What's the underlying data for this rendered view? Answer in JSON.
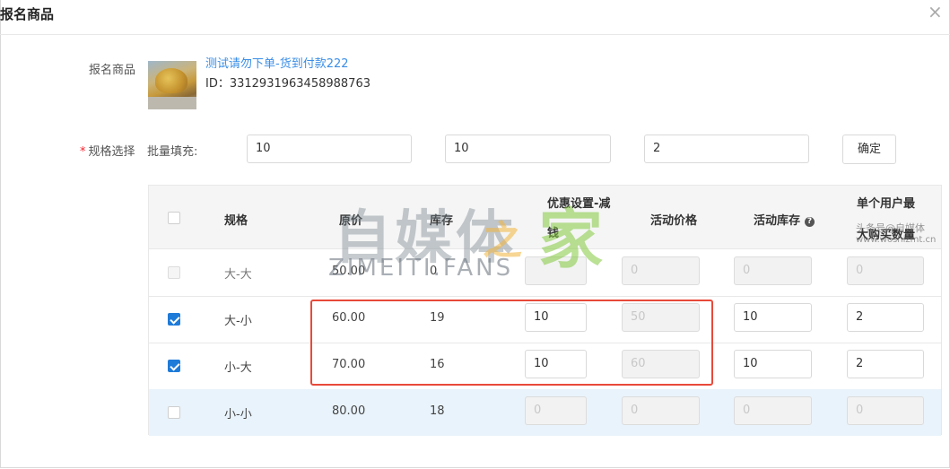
{
  "dialog": {
    "title": "报名商品",
    "close_icon": "×"
  },
  "product": {
    "label": "报名商品",
    "name": "测试请勿下单-货到付款222",
    "id_text": "ID：3312931963458988763",
    "thumbnail_icon": "tree-photo"
  },
  "spec": {
    "required_mark": "*",
    "label": "规格选择",
    "batch_label": "批量填充:",
    "batch_values": [
      "10",
      "10",
      "2"
    ],
    "confirm_label": "确定"
  },
  "table": {
    "headers": {
      "spec": "规格",
      "original_price": "原价",
      "stock": "库存",
      "discount_line1": "优惠设置-减",
      "discount_line2": "钱",
      "activity_price": "活动价格",
      "activity_stock": "活动库存",
      "limit_line1": "单个用户最",
      "limit_line2": "大购买数量"
    },
    "help_icon": "?",
    "rows": [
      {
        "checked": false,
        "spec": "大-大",
        "price": "50.00",
        "stock": "0",
        "discount": "",
        "activity_price": "0",
        "activity_stock": "0",
        "limit": "0"
      },
      {
        "checked": true,
        "spec": "大-小",
        "price": "60.00",
        "stock": "19",
        "discount": "10",
        "activity_price": "50",
        "activity_stock": "10",
        "limit": "2"
      },
      {
        "checked": true,
        "spec": "小-大",
        "price": "70.00",
        "stock": "16",
        "discount": "10",
        "activity_price": "60",
        "activity_stock": "10",
        "limit": "2"
      },
      {
        "checked": false,
        "spec": "小-小",
        "price": "80.00",
        "stock": "18",
        "discount": "0",
        "activity_price": "0",
        "activity_stock": "0",
        "limit": "0"
      }
    ]
  },
  "watermark": {
    "main": "自媒体",
    "zhi": "之",
    "jia": "家",
    "latin": "ZIMEITI.FANS",
    "small1": "头条号@自媒体",
    "small2": "www.woshizmt.cn"
  },
  "colors": {
    "accent": "#1f7bd8",
    "link": "#3a8ee6",
    "highlight_box": "#e8493a",
    "required": "#f5222d"
  }
}
